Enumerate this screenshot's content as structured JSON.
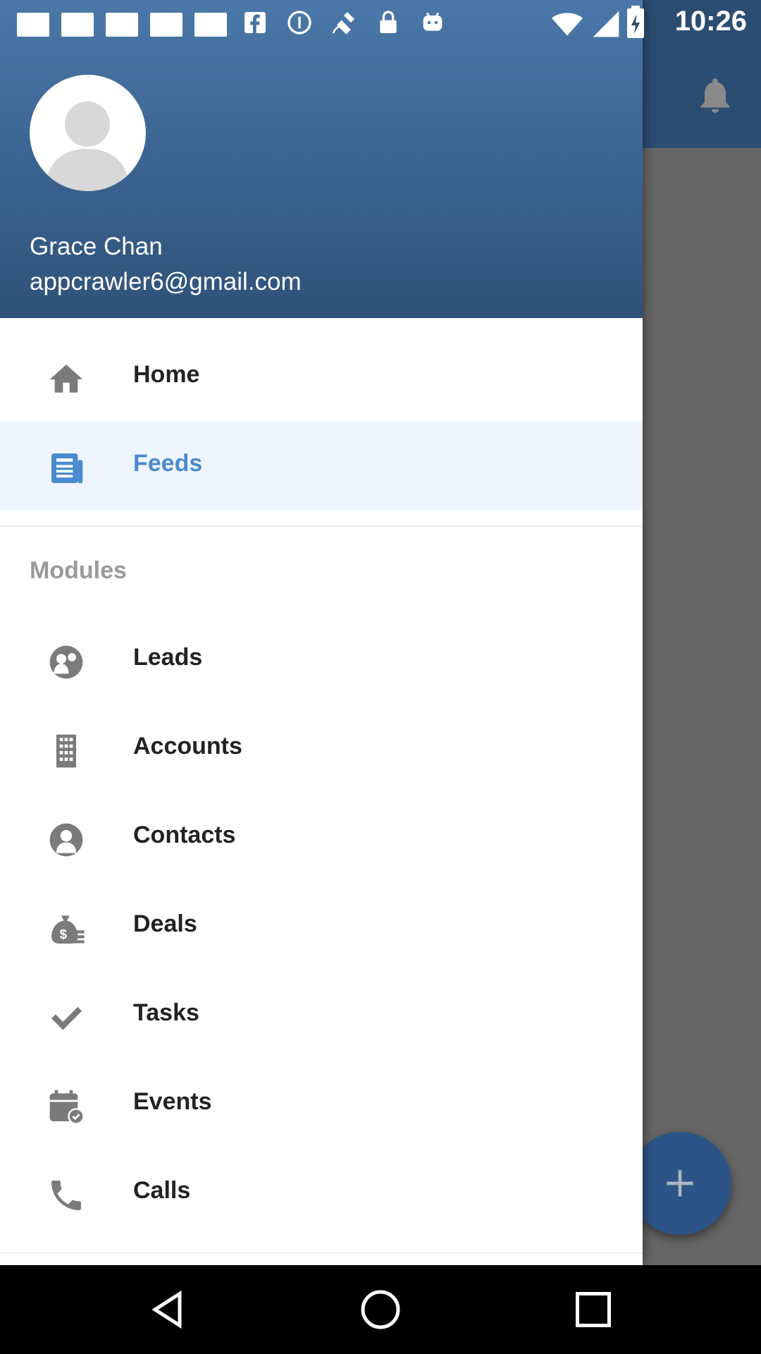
{
  "status_bar": {
    "time": "10:26",
    "icons": [
      "notification-square",
      "notification-square",
      "notification-square",
      "notification-square",
      "notification-square",
      "facebook-icon",
      "info-icon",
      "fake-gps-icon",
      "lock-icon",
      "android-icon",
      "wifi-icon",
      "signal-icon",
      "battery-icon"
    ]
  },
  "drawer": {
    "user": {
      "name": "Grace Chan",
      "email": "appcrawler6@gmail.com"
    },
    "primary_items": [
      {
        "label": "Home",
        "icon": "home-icon",
        "selected": false
      },
      {
        "label": "Feeds",
        "icon": "feeds-icon",
        "selected": true
      }
    ],
    "modules_heading": "Modules",
    "module_items": [
      {
        "label": "Leads",
        "icon": "leads-icon"
      },
      {
        "label": "Accounts",
        "icon": "building-icon"
      },
      {
        "label": "Contacts",
        "icon": "contact-icon"
      },
      {
        "label": "Deals",
        "icon": "money-bag-icon"
      },
      {
        "label": "Tasks",
        "icon": "check-icon"
      },
      {
        "label": "Events",
        "icon": "calendar-icon"
      },
      {
        "label": "Calls",
        "icon": "phone-icon"
      }
    ]
  },
  "colors": {
    "header": "#3d6694",
    "selected_text": "#4a8ad0",
    "selected_bg": "#eff5fc",
    "icon_gray": "#7b7b7b",
    "fab": "#2c5486"
  }
}
